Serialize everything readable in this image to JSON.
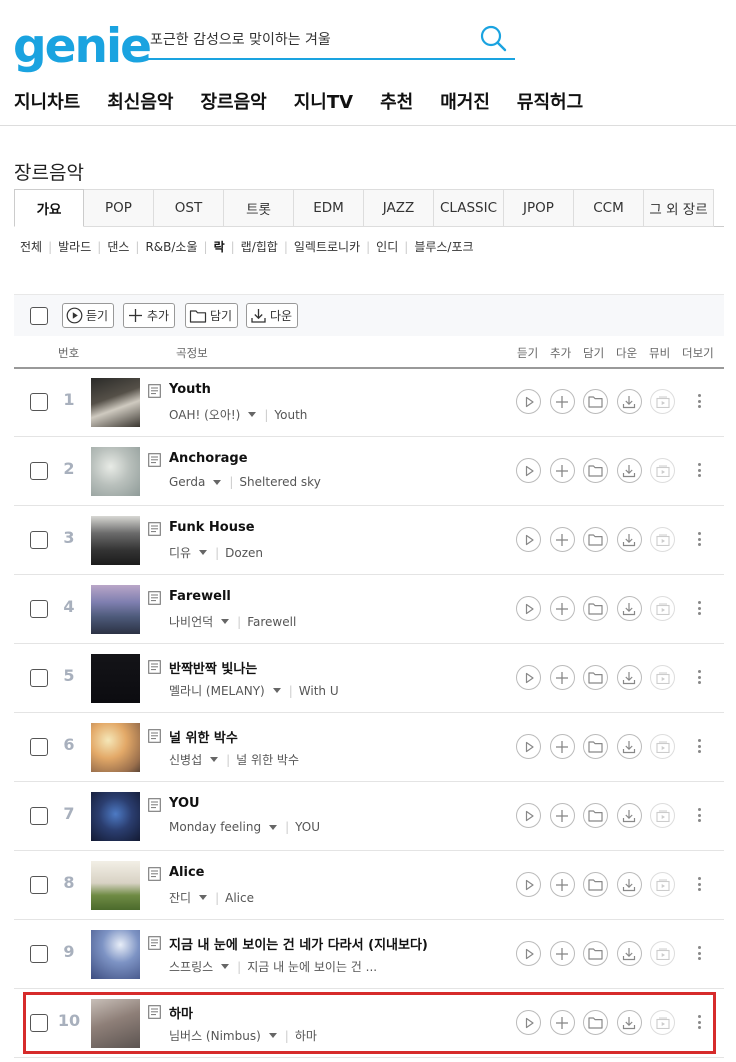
{
  "header": {
    "logo": "genie",
    "search_placeholder": "포근한 감성으로 맞이하는 겨울",
    "nav": [
      "지니차트",
      "최신음악",
      "장르음악",
      "지니TV",
      "추천",
      "매거진",
      "뮤직허그"
    ]
  },
  "page_title": "장르음악",
  "genre_tabs": [
    "가요",
    "POP",
    "OST",
    "트롯",
    "EDM",
    "JAZZ",
    "CLASSIC",
    "JPOP",
    "CCM",
    "그 외 장르"
  ],
  "active_tab": "가요",
  "subgenres": [
    "전체",
    "발라드",
    "댄스",
    "R&B/소울",
    "락",
    "랩/힙합",
    "일렉트로니카",
    "인디",
    "블루스/포크"
  ],
  "active_subgenre": "락",
  "toolbar": {
    "play": "듣기",
    "add": "추가",
    "save": "담기",
    "download": "다운"
  },
  "columns": {
    "rank": "번호",
    "info": "곡정보",
    "play": "듣기",
    "add": "추가",
    "save": "담기",
    "download": "다운",
    "mv": "뮤비",
    "more": "더보기"
  },
  "songs": [
    {
      "rank": "1",
      "title": "Youth",
      "artist": "OAH! (오아!)",
      "album": "Youth"
    },
    {
      "rank": "2",
      "title": "Anchorage",
      "artist": "Gerda",
      "album": "Sheltered sky"
    },
    {
      "rank": "3",
      "title": "Funk House",
      "artist": "디유",
      "album": "Dozen"
    },
    {
      "rank": "4",
      "title": "Farewell",
      "artist": "나비언덕",
      "album": "Farewell"
    },
    {
      "rank": "5",
      "title": "반짝반짝 빛나는",
      "artist": "멜라니 (MELANY)",
      "album": "With U"
    },
    {
      "rank": "6",
      "title": "널 위한 박수",
      "artist": "신병섭",
      "album": "널 위한 박수"
    },
    {
      "rank": "7",
      "title": "YOU",
      "artist": "Monday feeling",
      "album": "YOU"
    },
    {
      "rank": "8",
      "title": "Alice",
      "artist": "잔디",
      "album": "Alice"
    },
    {
      "rank": "9",
      "title": "지금 내 눈에 보이는 건 네가 다라서 (지내보다)",
      "artist": "스프링스",
      "album": "지금 내 눈에 보이는 건 ..."
    },
    {
      "rank": "10",
      "title": "하마",
      "artist": "님버스 (Nimbus)",
      "album": "하마"
    }
  ],
  "colors": {
    "brand": "#1aa3e0",
    "highlight": "#d62b2b",
    "rank": "#a8b0bd"
  }
}
